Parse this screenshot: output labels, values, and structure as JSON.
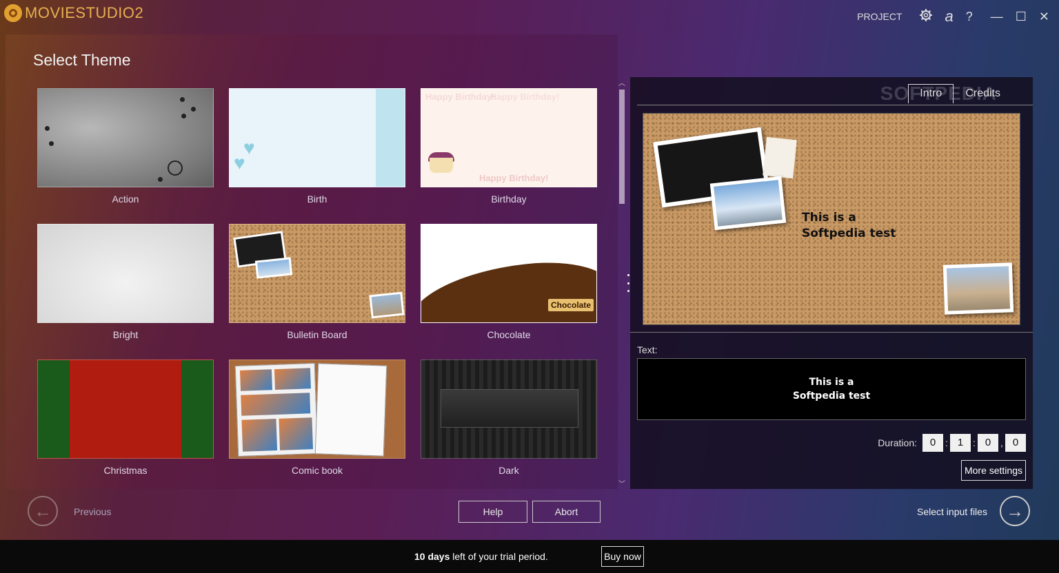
{
  "app": {
    "logo_text": "MOVIESTUDIO2",
    "project_label": "PROJECT",
    "settings_icon": "gear-icon",
    "account_glyph": "a",
    "help_glyph": "?",
    "minimize_glyph": "—",
    "maximize_glyph": "☐",
    "close_glyph": "✕"
  },
  "page": {
    "title": "Select Theme"
  },
  "themes": [
    {
      "label": "Action"
    },
    {
      "label": "Birth"
    },
    {
      "label": "Birthday"
    },
    {
      "label": "Bright"
    },
    {
      "label": "Bulletin Board"
    },
    {
      "label": "Chocolate"
    },
    {
      "label": "Christmas"
    },
    {
      "label": "Comic book"
    },
    {
      "label": "Dark"
    }
  ],
  "thumb_text": {
    "birthday_greeting": "Happy Birthday!",
    "chocolate_badge": "Chocolate"
  },
  "preview_panel": {
    "tabs": [
      {
        "label": "Intro",
        "active": true
      },
      {
        "label": "Credits",
        "active": false
      }
    ],
    "watermark": "SOFTPEDIA",
    "preview_text_line1": "This is a",
    "preview_text_line2": "Softpedia test",
    "text_label": "Text:",
    "text_line1": "This is a",
    "text_line2": "Softpedia test",
    "duration_label": "Duration:",
    "duration": [
      "0",
      "1",
      "0",
      "0"
    ],
    "duration_separators": [
      ":",
      ":",
      ","
    ],
    "more_settings_label": "More settings"
  },
  "nav": {
    "previous_label": "Previous",
    "help_label": "Help",
    "abort_label": "Abort",
    "next_label": "Select input files"
  },
  "trial": {
    "days": "10 days",
    "message": " left of your trial period.",
    "buy_label": "Buy now"
  },
  "colors": {
    "logo": "#e6b050",
    "trial_bar": "#0a0a0a",
    "panel": "#140e20"
  }
}
